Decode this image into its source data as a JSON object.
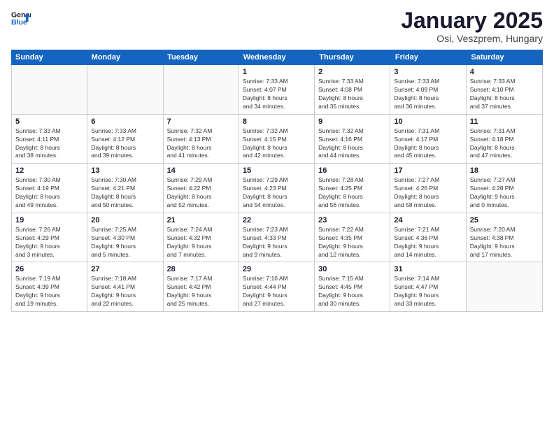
{
  "logo": {
    "line1": "General",
    "line2": "Blue"
  },
  "title": "January 2025",
  "subtitle": "Osi, Veszprem, Hungary",
  "days_of_week": [
    "Sunday",
    "Monday",
    "Tuesday",
    "Wednesday",
    "Thursday",
    "Friday",
    "Saturday"
  ],
  "weeks": [
    [
      {
        "day": "",
        "info": ""
      },
      {
        "day": "",
        "info": ""
      },
      {
        "day": "",
        "info": ""
      },
      {
        "day": "1",
        "info": "Sunrise: 7:33 AM\nSunset: 4:07 PM\nDaylight: 8 hours\nand 34 minutes."
      },
      {
        "day": "2",
        "info": "Sunrise: 7:33 AM\nSunset: 4:08 PM\nDaylight: 8 hours\nand 35 minutes."
      },
      {
        "day": "3",
        "info": "Sunrise: 7:33 AM\nSunset: 4:09 PM\nDaylight: 8 hours\nand 36 minutes."
      },
      {
        "day": "4",
        "info": "Sunrise: 7:33 AM\nSunset: 4:10 PM\nDaylight: 8 hours\nand 37 minutes."
      }
    ],
    [
      {
        "day": "5",
        "info": "Sunrise: 7:33 AM\nSunset: 4:11 PM\nDaylight: 8 hours\nand 38 minutes."
      },
      {
        "day": "6",
        "info": "Sunrise: 7:33 AM\nSunset: 4:12 PM\nDaylight: 8 hours\nand 39 minutes."
      },
      {
        "day": "7",
        "info": "Sunrise: 7:32 AM\nSunset: 4:13 PM\nDaylight: 8 hours\nand 41 minutes."
      },
      {
        "day": "8",
        "info": "Sunrise: 7:32 AM\nSunset: 4:15 PM\nDaylight: 8 hours\nand 42 minutes."
      },
      {
        "day": "9",
        "info": "Sunrise: 7:32 AM\nSunset: 4:16 PM\nDaylight: 8 hours\nand 44 minutes."
      },
      {
        "day": "10",
        "info": "Sunrise: 7:31 AM\nSunset: 4:17 PM\nDaylight: 8 hours\nand 45 minutes."
      },
      {
        "day": "11",
        "info": "Sunrise: 7:31 AM\nSunset: 4:18 PM\nDaylight: 8 hours\nand 47 minutes."
      }
    ],
    [
      {
        "day": "12",
        "info": "Sunrise: 7:30 AM\nSunset: 4:19 PM\nDaylight: 8 hours\nand 49 minutes."
      },
      {
        "day": "13",
        "info": "Sunrise: 7:30 AM\nSunset: 4:21 PM\nDaylight: 8 hours\nand 50 minutes."
      },
      {
        "day": "14",
        "info": "Sunrise: 7:29 AM\nSunset: 4:22 PM\nDaylight: 8 hours\nand 52 minutes."
      },
      {
        "day": "15",
        "info": "Sunrise: 7:29 AM\nSunset: 4:23 PM\nDaylight: 8 hours\nand 54 minutes."
      },
      {
        "day": "16",
        "info": "Sunrise: 7:28 AM\nSunset: 4:25 PM\nDaylight: 8 hours\nand 56 minutes."
      },
      {
        "day": "17",
        "info": "Sunrise: 7:27 AM\nSunset: 4:26 PM\nDaylight: 8 hours\nand 58 minutes."
      },
      {
        "day": "18",
        "info": "Sunrise: 7:27 AM\nSunset: 4:28 PM\nDaylight: 9 hours\nand 0 minutes."
      }
    ],
    [
      {
        "day": "19",
        "info": "Sunrise: 7:26 AM\nSunset: 4:29 PM\nDaylight: 9 hours\nand 3 minutes."
      },
      {
        "day": "20",
        "info": "Sunrise: 7:25 AM\nSunset: 4:30 PM\nDaylight: 9 hours\nand 5 minutes."
      },
      {
        "day": "21",
        "info": "Sunrise: 7:24 AM\nSunset: 4:32 PM\nDaylight: 9 hours\nand 7 minutes."
      },
      {
        "day": "22",
        "info": "Sunrise: 7:23 AM\nSunset: 4:33 PM\nDaylight: 9 hours\nand 9 minutes."
      },
      {
        "day": "23",
        "info": "Sunrise: 7:22 AM\nSunset: 4:35 PM\nDaylight: 9 hours\nand 12 minutes."
      },
      {
        "day": "24",
        "info": "Sunrise: 7:21 AM\nSunset: 4:36 PM\nDaylight: 9 hours\nand 14 minutes."
      },
      {
        "day": "25",
        "info": "Sunrise: 7:20 AM\nSunset: 4:38 PM\nDaylight: 9 hours\nand 17 minutes."
      }
    ],
    [
      {
        "day": "26",
        "info": "Sunrise: 7:19 AM\nSunset: 4:39 PM\nDaylight: 9 hours\nand 19 minutes."
      },
      {
        "day": "27",
        "info": "Sunrise: 7:18 AM\nSunset: 4:41 PM\nDaylight: 9 hours\nand 22 minutes."
      },
      {
        "day": "28",
        "info": "Sunrise: 7:17 AM\nSunset: 4:42 PM\nDaylight: 9 hours\nand 25 minutes."
      },
      {
        "day": "29",
        "info": "Sunrise: 7:16 AM\nSunset: 4:44 PM\nDaylight: 9 hours\nand 27 minutes."
      },
      {
        "day": "30",
        "info": "Sunrise: 7:15 AM\nSunset: 4:45 PM\nDaylight: 9 hours\nand 30 minutes."
      },
      {
        "day": "31",
        "info": "Sunrise: 7:14 AM\nSunset: 4:47 PM\nDaylight: 9 hours\nand 33 minutes."
      },
      {
        "day": "",
        "info": ""
      }
    ]
  ]
}
